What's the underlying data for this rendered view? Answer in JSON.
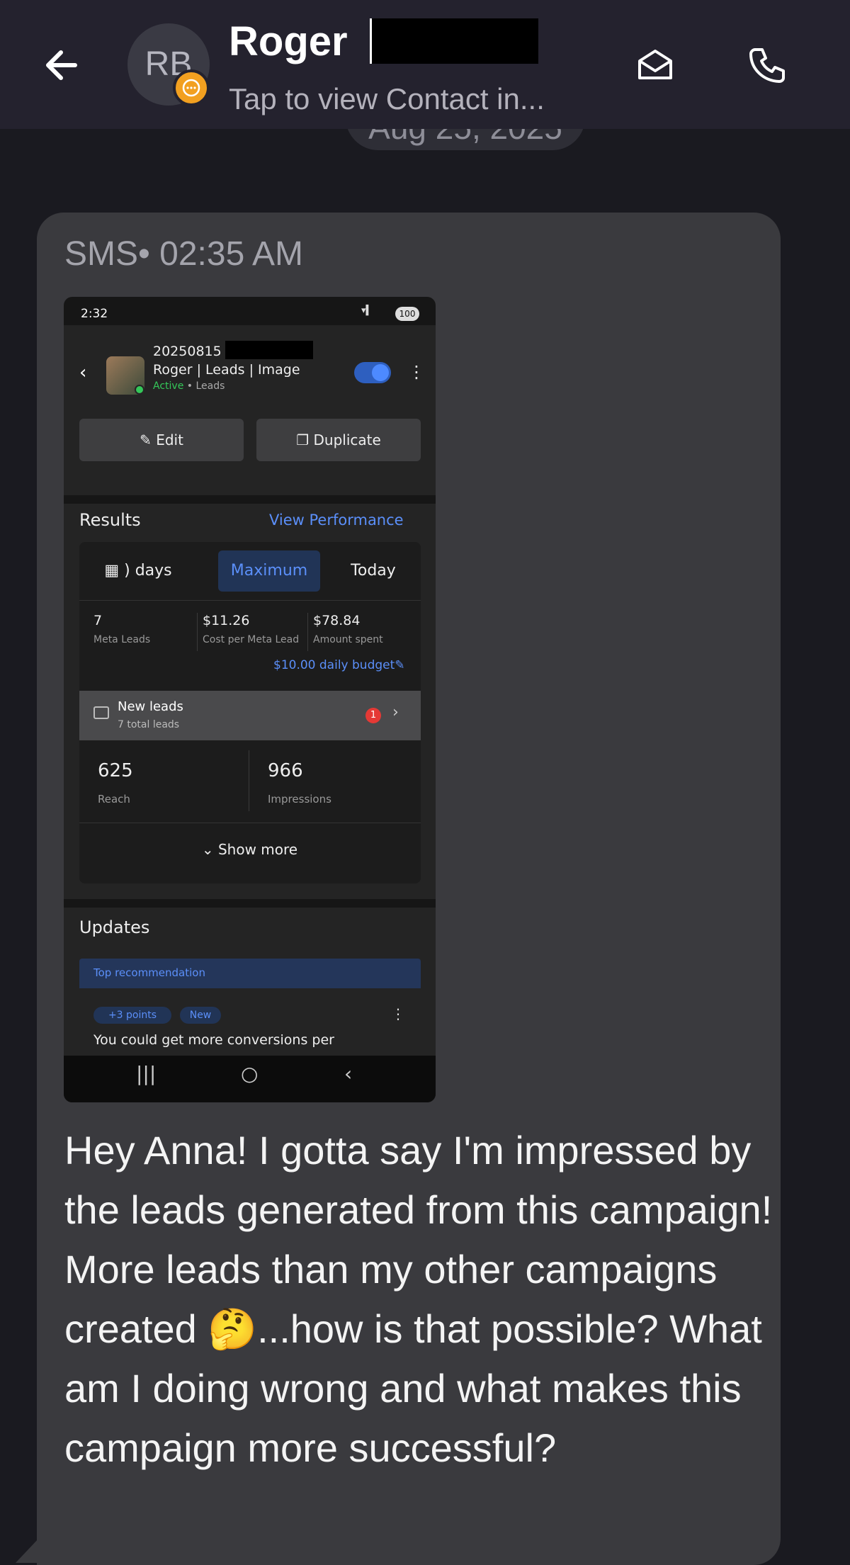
{
  "header": {
    "avatar_initials": "RB",
    "contact_name": "Roger",
    "contact_subtitle": "Tap to view Contact in...",
    "date_chip": "Aug 25, 2025"
  },
  "message": {
    "channel_time": "SMS• 02:35 AM",
    "text": "Hey Anna! I gotta say I'm impressed by the leads generated from this campaign! More leads than my other campaigns created 🤔...how is that possible? What am I doing wrong and what makes this campaign more successful?"
  },
  "screenshot": {
    "status_time": "2:32",
    "battery": "100",
    "campaign_id": "20250815",
    "campaign_name": "Roger | Leads | Image",
    "status_active": "Active",
    "status_type": "• Leads",
    "edit_label": "Edit",
    "duplicate_label": "Duplicate",
    "results_title": "Results",
    "view_performance": "View Performance",
    "range_days": ") days",
    "range_maximum": "Maximum",
    "range_today": "Today",
    "metrics": [
      {
        "value": "7",
        "label": "Meta Leads"
      },
      {
        "value": "$11.26",
        "label": "Cost per Meta Lead"
      },
      {
        "value": "$78.84",
        "label": "Amount spent"
      }
    ],
    "budget": "$10.00 daily budget",
    "new_leads_title": "New leads",
    "new_leads_sub": "7 total leads",
    "new_leads_badge": "1",
    "reach_value": "625",
    "reach_label": "Reach",
    "impressions_value": "966",
    "impressions_label": "Impressions",
    "show_more": "Show more",
    "updates_title": "Updates",
    "top_recommendation": "Top recommendation",
    "points_pill": "+3 points",
    "new_pill": "New",
    "rec_text": "You could get more conversions per"
  },
  "colors": {
    "accent_blue": "#5b8ff9",
    "active_green": "#34c759",
    "badge_red": "#e53935",
    "avatar_badge": "#f2a020"
  }
}
